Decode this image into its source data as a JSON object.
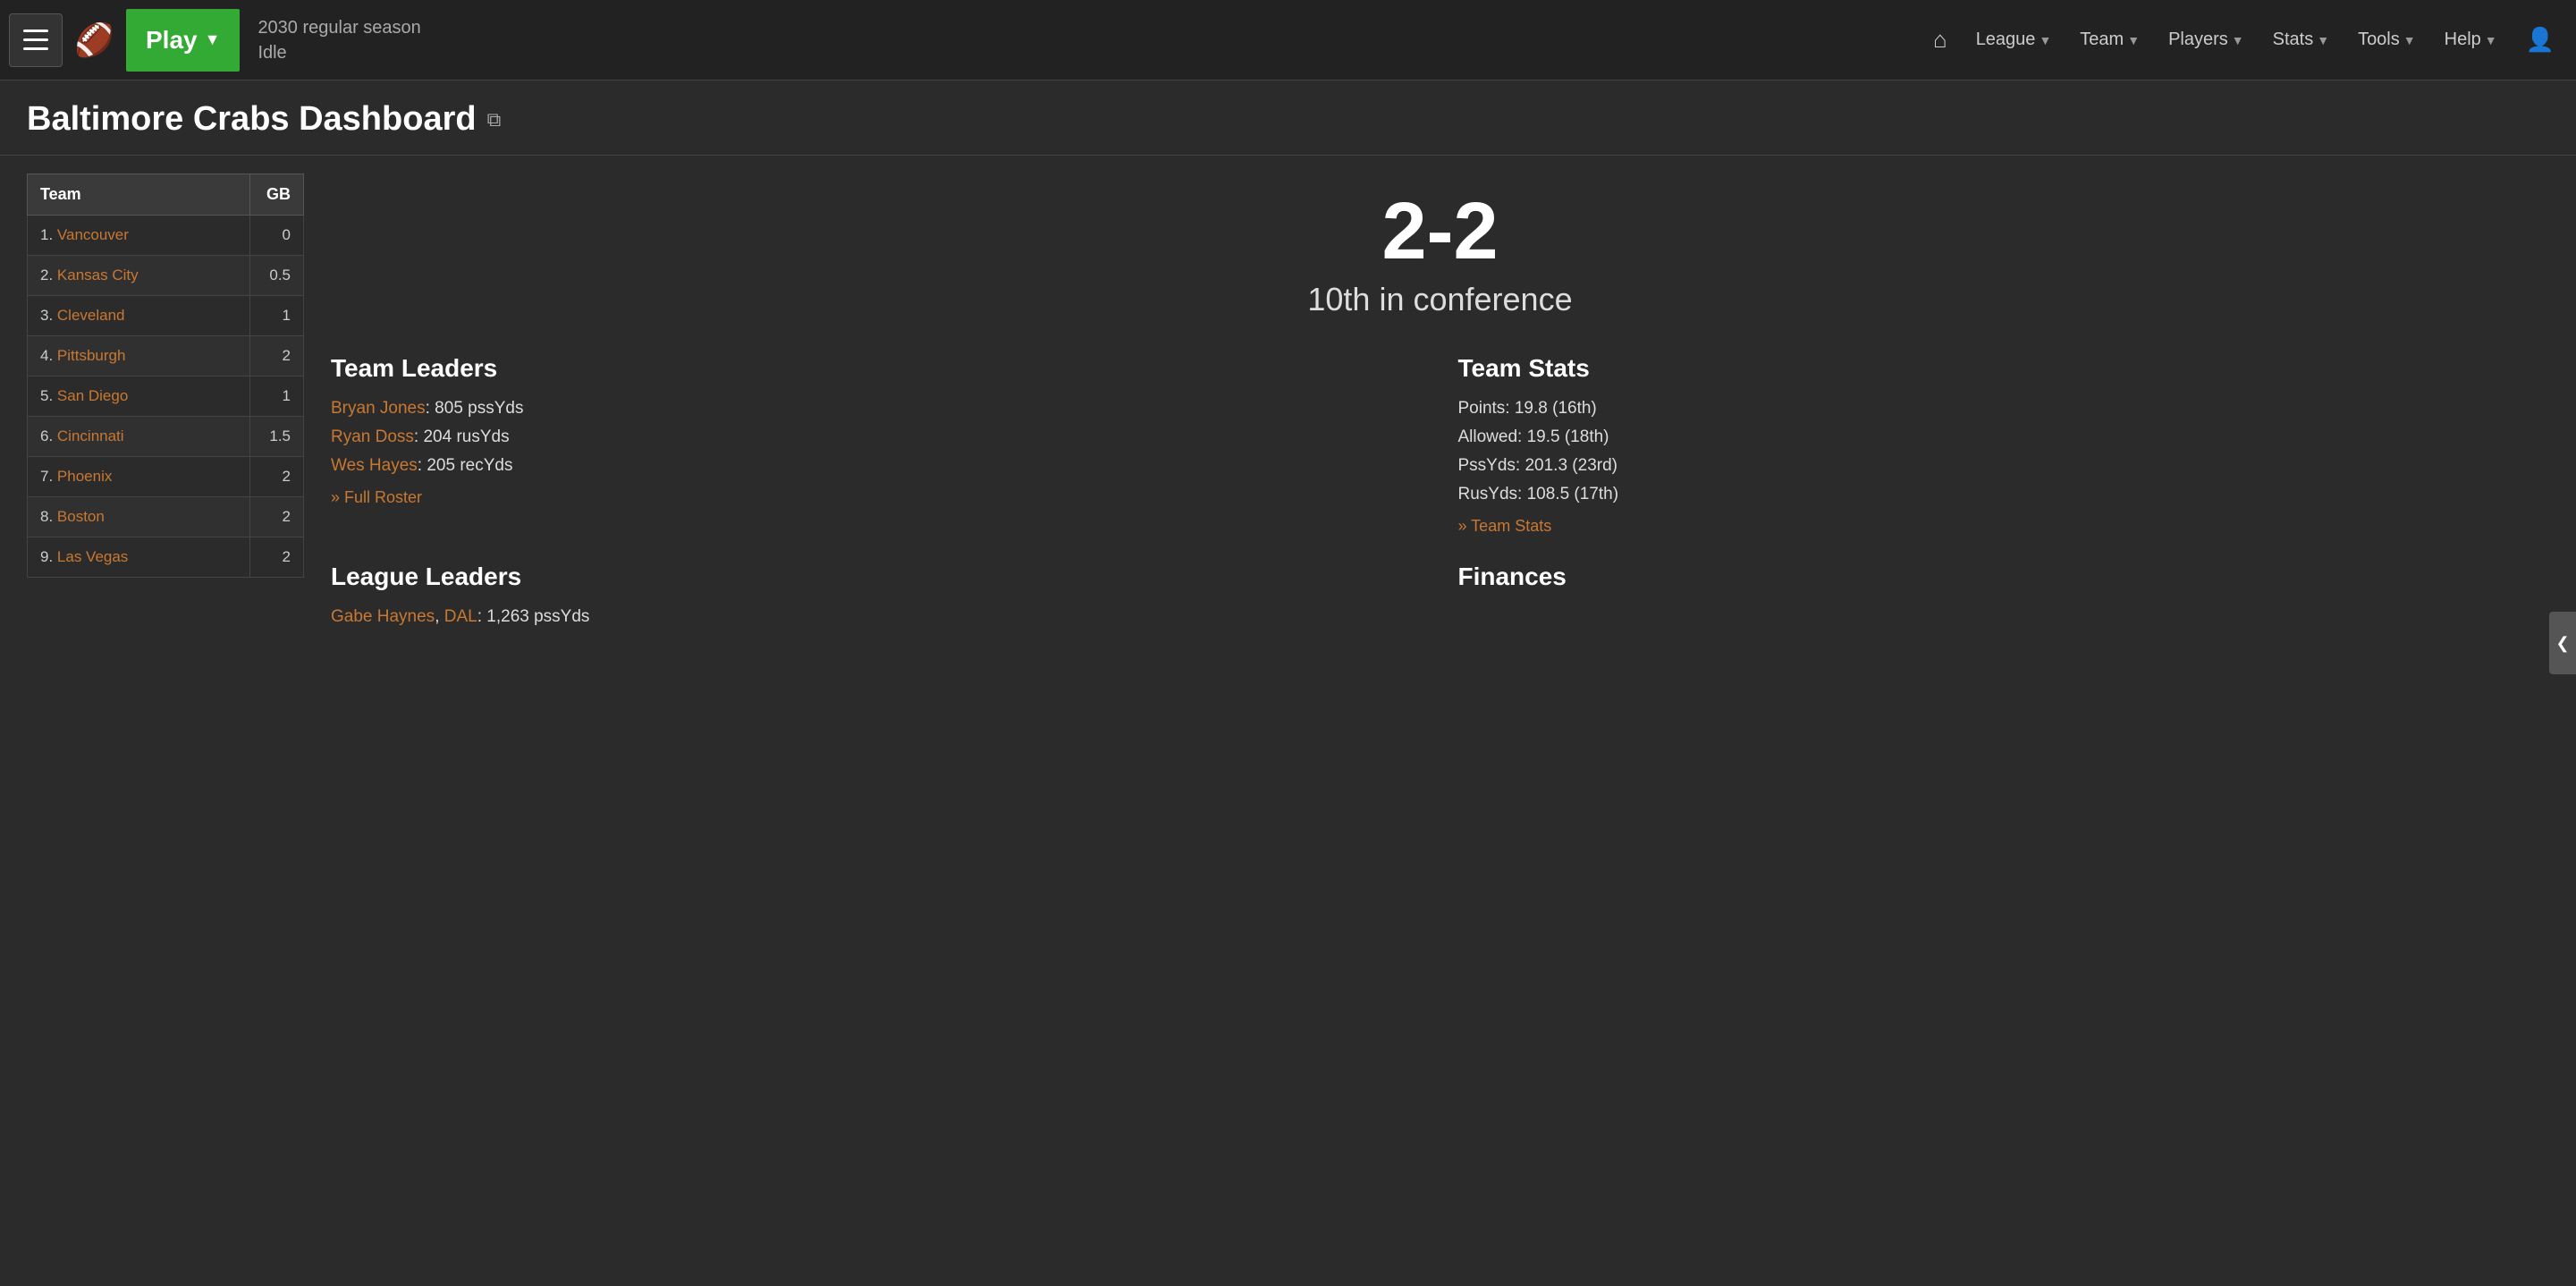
{
  "navbar": {
    "play_label": "Play",
    "play_arrow": "▼",
    "status_line1": "2030 regular season",
    "status_line2": "Idle",
    "home_icon": "⌂",
    "links": [
      {
        "label": "League",
        "has_arrow": true
      },
      {
        "label": "Team",
        "has_arrow": true
      },
      {
        "label": "Players",
        "has_arrow": true
      },
      {
        "label": "Stats",
        "has_arrow": true
      },
      {
        "label": "Tools",
        "has_arrow": true
      },
      {
        "label": "Help",
        "has_arrow": true
      }
    ]
  },
  "page": {
    "title": "Baltimore Crabs Dashboard",
    "ext_icon": "⧉"
  },
  "sidebar_toggle": "❮",
  "standings": {
    "col_team": "Team",
    "col_gb": "GB",
    "rows": [
      {
        "rank": 1,
        "team": "Vancouver",
        "gb": "0"
      },
      {
        "rank": 2,
        "team": "Kansas City",
        "gb": "0.5"
      },
      {
        "rank": 3,
        "team": "Cleveland",
        "gb": "1"
      },
      {
        "rank": 4,
        "team": "Pittsburgh",
        "gb": "2"
      },
      {
        "rank": 5,
        "team": "San Diego",
        "gb": "1"
      },
      {
        "rank": 6,
        "team": "Cincinnati",
        "gb": "1.5"
      },
      {
        "rank": 7,
        "team": "Phoenix",
        "gb": "2"
      },
      {
        "rank": 8,
        "team": "Boston",
        "gb": "2"
      },
      {
        "rank": 9,
        "team": "Las Vegas",
        "gb": "2"
      }
    ]
  },
  "record": {
    "value": "2-2",
    "conference": "10th in conference"
  },
  "team_leaders": {
    "title": "Team Leaders",
    "leaders": [
      {
        "player": "Bryan Jones",
        "stat": "805 pssYds"
      },
      {
        "player": "Ryan Doss",
        "stat": "204 rusYds"
      },
      {
        "player": "Wes Hayes",
        "stat": "205 recYds"
      }
    ],
    "full_roster_link": "» Full Roster"
  },
  "team_stats": {
    "title": "Team Stats",
    "stats": [
      {
        "label": "Points",
        "value": "19.8 (16th)"
      },
      {
        "label": "Allowed",
        "value": "19.5 (18th)"
      },
      {
        "label": "PssYds",
        "value": "201.3 (23rd)"
      },
      {
        "label": "RusYds",
        "value": "108.5 (17th)"
      }
    ],
    "link": "» Team Stats"
  },
  "league_leaders": {
    "title": "League Leaders",
    "leaders": [
      {
        "player": "Gabe Haynes",
        "team": "DAL",
        "stat": "1,263 pssYds"
      }
    ]
  },
  "finances": {
    "title": "Finances"
  }
}
